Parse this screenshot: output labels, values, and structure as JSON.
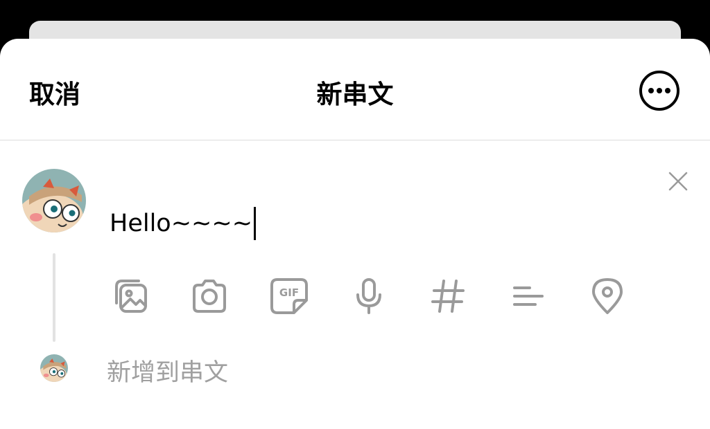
{
  "header": {
    "cancel_label": "取消",
    "title": "新串文",
    "more_icon": "more-horizontal-circle-icon"
  },
  "composer": {
    "text": "Hello~~~~",
    "clear_icon": "close-icon"
  },
  "toolbar": {
    "icons": [
      "gallery-icon",
      "camera-icon",
      "gif-icon",
      "microphone-icon",
      "hashtag-icon",
      "poll-icon",
      "location-pin-icon"
    ],
    "gif_label": "GIF"
  },
  "thread": {
    "add_placeholder": "新增到串文"
  },
  "colors": {
    "background": "#000000",
    "sheet": "#ffffff",
    "icon_gray": "#9a9a9a",
    "placeholder_gray": "#a0a0a0",
    "divider": "#dcdcdc"
  }
}
